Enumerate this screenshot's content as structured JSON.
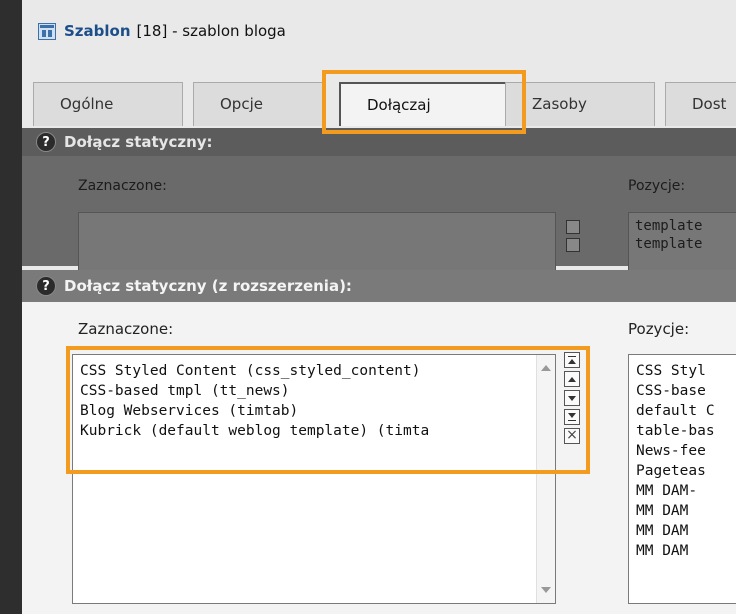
{
  "window": {
    "title_bold": "Szablon",
    "title_rest": "[18] - szablon bloga"
  },
  "tabs": [
    {
      "label": "Ogólne"
    },
    {
      "label": "Opcje"
    },
    {
      "label": "Dołączaj",
      "active": true
    },
    {
      "label": "Zasoby"
    },
    {
      "label": "Dost"
    }
  ],
  "section_static": {
    "heading": "Dołącz statyczny:",
    "help_glyph": "?",
    "selected_label": "Zaznaczone:",
    "items_label": "Pozycje:",
    "items_preview": [
      "template",
      "template"
    ]
  },
  "section_ext": {
    "heading": "Dołącz statyczny (z rozszerzenia):",
    "help_glyph": "?",
    "selected_label": "Zaznaczone:",
    "items_label": "Pozycje:",
    "selected": [
      "CSS Styled Content (css_styled_content)",
      "CSS-based tmpl (tt_news)",
      "Blog Webservices (timtab)",
      "Kubrick (default weblog template) (timta"
    ],
    "available": [
      "CSS Styl",
      "CSS-base",
      "default C",
      "table-bas",
      "News-fee",
      "Pageteas",
      "MM DAM-",
      "MM DAM ",
      "MM DAM ",
      "MM DAM "
    ],
    "remove_glyph": "×"
  },
  "accent_color": "#f39b1f"
}
